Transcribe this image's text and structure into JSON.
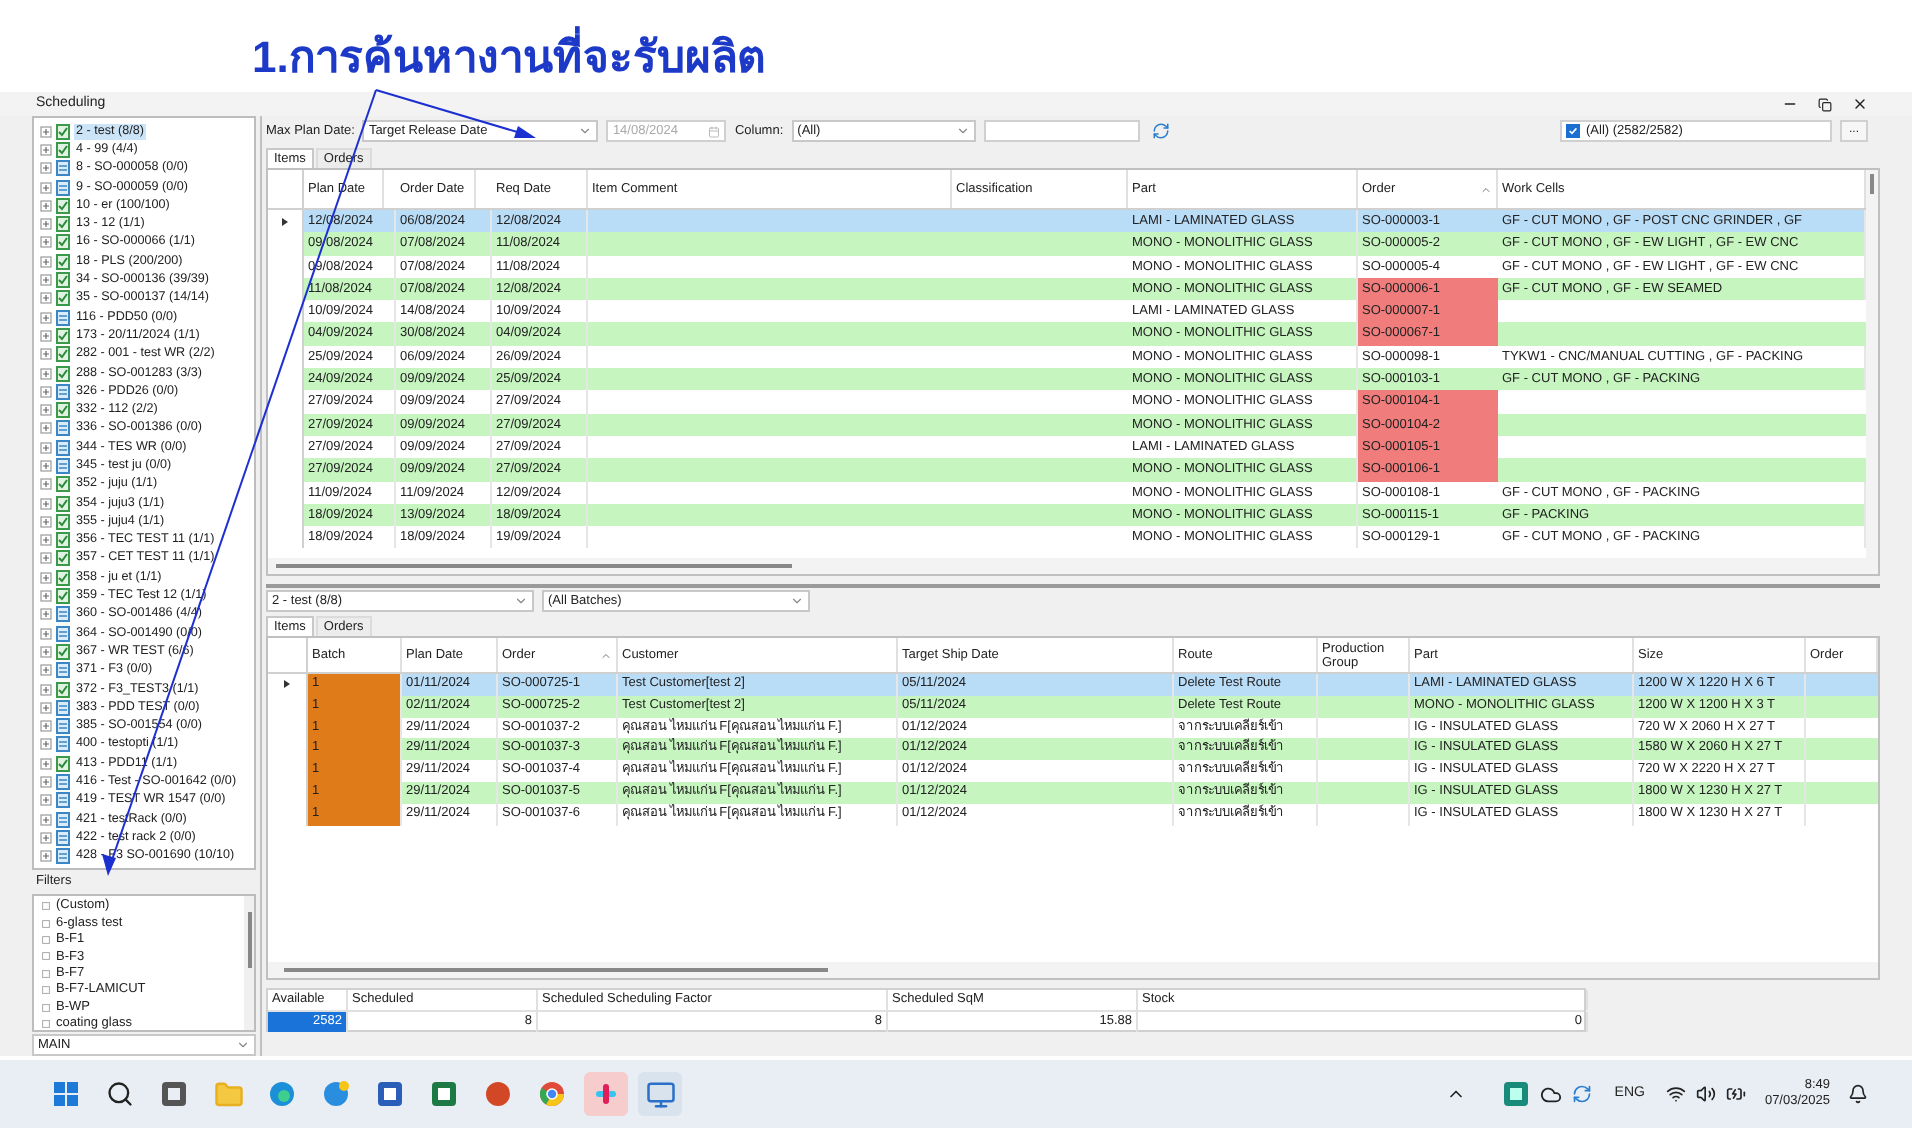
{
  "annotation": {
    "title": "1.การค้นหางานที่จะรับผลิต"
  },
  "window": {
    "title": "Scheduling"
  },
  "tree": [
    {
      "label": "2 - test (8/8)",
      "kind": "complete",
      "selected": true
    },
    {
      "label": "4 - 99 (4/4)",
      "kind": "complete",
      "selected": false
    },
    {
      "label": "8 - SO-000058 (0/0)",
      "kind": "empty",
      "selected": false
    },
    {
      "label": "9 - SO-000059 (0/0)",
      "kind": "empty",
      "selected": false
    },
    {
      "label": "10 - er (100/100)",
      "kind": "complete",
      "selected": false
    },
    {
      "label": "13 - 12 (1/1)",
      "kind": "complete",
      "selected": false
    },
    {
      "label": "16 - SO-000066 (1/1)",
      "kind": "complete",
      "selected": false
    },
    {
      "label": "18 - PLS (200/200)",
      "kind": "complete",
      "selected": false
    },
    {
      "label": "34 - SO-000136 (39/39)",
      "kind": "complete",
      "selected": false
    },
    {
      "label": "35 - SO-000137 (14/14)",
      "kind": "complete",
      "selected": false
    },
    {
      "label": "116 - PDD50 (0/0)",
      "kind": "empty",
      "selected": false
    },
    {
      "label": "173 - 20/11/2024 (1/1)",
      "kind": "complete",
      "selected": false
    },
    {
      "label": "282 - 001 - test WR (2/2)",
      "kind": "complete",
      "selected": false
    },
    {
      "label": "288 - SO-001283 (3/3)",
      "kind": "complete",
      "selected": false
    },
    {
      "label": "326 - PDD26 (0/0)",
      "kind": "empty",
      "selected": false
    },
    {
      "label": "332 - 112 (2/2)",
      "kind": "complete",
      "selected": false
    },
    {
      "label": "336 - SO-001386 (0/0)",
      "kind": "empty",
      "selected": false
    },
    {
      "label": "344 - TES WR (0/0)",
      "kind": "empty",
      "selected": false
    },
    {
      "label": "345 - test ju (0/0)",
      "kind": "empty",
      "selected": false
    },
    {
      "label": "352 - juju (1/1)",
      "kind": "complete",
      "selected": false
    },
    {
      "label": "354 - juju3 (1/1)",
      "kind": "complete",
      "selected": false
    },
    {
      "label": "355 - juju4 (1/1)",
      "kind": "complete",
      "selected": false
    },
    {
      "label": "356 - TEC TEST 11 (1/1)",
      "kind": "complete",
      "selected": false
    },
    {
      "label": "357 - CET TEST 11 (1/1)",
      "kind": "complete",
      "selected": false
    },
    {
      "label": "358 - ju et (1/1)",
      "kind": "complete",
      "selected": false
    },
    {
      "label": "359 - TEC Test 12 (1/1)",
      "kind": "complete",
      "selected": false
    },
    {
      "label": "360 - SO-001486 (4/4)",
      "kind": "empty",
      "selected": false
    },
    {
      "label": "364 - SO-001490 (0/0)",
      "kind": "empty",
      "selected": false
    },
    {
      "label": "367 - WR TEST (6/6)",
      "kind": "complete",
      "selected": false
    },
    {
      "label": "371 - F3 (0/0)",
      "kind": "empty",
      "selected": false
    },
    {
      "label": "372 - F3_TEST3 (1/1)",
      "kind": "complete",
      "selected": false
    },
    {
      "label": "383 - PDD TEST (0/0)",
      "kind": "empty",
      "selected": false
    },
    {
      "label": "385 - SO-001554 (0/0)",
      "kind": "empty",
      "selected": false
    },
    {
      "label": "400 - testopti (1/1)",
      "kind": "empty",
      "selected": false
    },
    {
      "label": "413 - PDD11 (1/1)",
      "kind": "complete",
      "selected": false
    },
    {
      "label": "416 - Test - SO-001642 (0/0)",
      "kind": "empty",
      "selected": false
    },
    {
      "label": "419 - TEST WR 1547 (0/0)",
      "kind": "empty",
      "selected": false
    },
    {
      "label": "421 - testRack (0/0)",
      "kind": "empty",
      "selected": false
    },
    {
      "label": "422 - test rack 2 (0/0)",
      "kind": "empty",
      "selected": false
    },
    {
      "label": "428 - F3 SO-001690 (10/10)",
      "kind": "empty",
      "selected": false
    }
  ],
  "filters": {
    "title": "Filters",
    "items": [
      "(Custom)",
      "6-glass test",
      "B-F1",
      "B-F3",
      "B-F7",
      "B-F7-LAMICUT",
      "B-WP",
      "coating glass"
    ],
    "group": "MAIN"
  },
  "toolbar": {
    "max_plan_date_label": "Max Plan Date:",
    "date_type": "Target Release Date",
    "date": "14/08/2024",
    "columns_label": "Column:",
    "columns_value": "(All)",
    "all_filter": {
      "label": "(All) (2582/2582)",
      "checked": true
    },
    "more_button": "..."
  },
  "top_tabs": [
    {
      "label": "Items",
      "selected": true
    },
    {
      "label": "Orders",
      "selected": false
    }
  ],
  "items_table": {
    "columns": [
      "Plan Date",
      "Order Date",
      "Req Date",
      "Item Comment",
      "Classification",
      "Part",
      "Order",
      "Work Cells"
    ],
    "rows": [
      {
        "plan_date": "12/08/2024",
        "order_date": "06/08/2024",
        "req_date": "12/08/2024",
        "part": "LAMI - LAMINATED GLASS",
        "order": "SO-000003-1",
        "order_flagged": false,
        "work_cells": "GF - CUT MONO , GF - POST CNC GRINDER , GF",
        "selected": true
      },
      {
        "plan_date": "09/08/2024",
        "order_date": "07/08/2024",
        "req_date": "11/08/2024",
        "part": "MONO - MONOLITHIC GLASS",
        "order": "SO-000005-2",
        "order_flagged": false,
        "work_cells": "GF - CUT MONO , GF - EW LIGHT , GF - EW CNC",
        "selected": false
      },
      {
        "plan_date": "09/08/2024",
        "order_date": "07/08/2024",
        "req_date": "11/08/2024",
        "part": "MONO - MONOLITHIC GLASS",
        "order": "SO-000005-4",
        "order_flagged": false,
        "work_cells": "GF - CUT MONO , GF - EW LIGHT , GF - EW CNC",
        "selected": false
      },
      {
        "plan_date": "11/08/2024",
        "order_date": "07/08/2024",
        "req_date": "12/08/2024",
        "part": "MONO - MONOLITHIC GLASS",
        "order": "SO-000006-1",
        "order_flagged": true,
        "work_cells": "GF - CUT MONO , GF - EW SEAMED",
        "selected": false
      },
      {
        "plan_date": "10/09/2024",
        "order_date": "14/08/2024",
        "req_date": "10/09/2024",
        "part": "LAMI - LAMINATED GLASS",
        "order": "SO-000007-1",
        "order_flagged": true,
        "selected": false
      },
      {
        "plan_date": "04/09/2024",
        "order_date": "30/08/2024",
        "req_date": "04/09/2024",
        "part": "MONO - MONOLITHIC GLASS",
        "order": "SO-000067-1",
        "order_flagged": true,
        "selected": false
      },
      {
        "plan_date": "25/09/2024",
        "order_date": "06/09/2024",
        "req_date": "26/09/2024",
        "part": "MONO - MONOLITHIC GLASS",
        "order": "SO-000098-1",
        "order_flagged": false,
        "work_cells": "TYKW1 - CNC/MANUAL CUTTING , GF - PACKING",
        "selected": false
      },
      {
        "plan_date": "24/09/2024",
        "order_date": "09/09/2024",
        "req_date": "25/09/2024",
        "part": "MONO - MONOLITHIC GLASS",
        "order": "SO-000103-1",
        "order_flagged": false,
        "work_cells": "GF - CUT MONO , GF - PACKING",
        "selected": false
      },
      {
        "plan_date": "27/09/2024",
        "order_date": "09/09/2024",
        "req_date": "27/09/2024",
        "part": "MONO - MONOLITHIC GLASS",
        "order": "SO-000104-1",
        "order_flagged": true,
        "selected": false
      },
      {
        "plan_date": "27/09/2024",
        "order_date": "09/09/2024",
        "req_date": "27/09/2024",
        "part": "MONO - MONOLITHIC GLASS",
        "order": "SO-000104-2",
        "order_flagged": true,
        "selected": false
      },
      {
        "plan_date": "27/09/2024",
        "order_date": "09/09/2024",
        "req_date": "27/09/2024",
        "part": "LAMI - LAMINATED GLASS",
        "order": "SO-000105-1",
        "order_flagged": true,
        "selected": false
      },
      {
        "plan_date": "27/09/2024",
        "order_date": "09/09/2024",
        "req_date": "27/09/2024",
        "part": "MONO - MONOLITHIC GLASS",
        "order": "SO-000106-1",
        "order_flagged": true,
        "selected": false
      },
      {
        "plan_date": "11/09/2024",
        "order_date": "11/09/2024",
        "req_date": "12/09/2024",
        "part": "MONO - MONOLITHIC GLASS",
        "order": "SO-000108-1",
        "order_flagged": false,
        "work_cells": "GF - CUT MONO , GF - PACKING",
        "selected": false
      },
      {
        "plan_date": "18/09/2024",
        "order_date": "13/09/2024",
        "req_date": "18/09/2024",
        "part": "MONO - MONOLITHIC GLASS",
        "order": "SO-000115-1",
        "order_flagged": false,
        "work_cells": "GF - PACKING",
        "selected": false
      },
      {
        "plan_date": "18/09/2024",
        "order_date": "18/09/2024",
        "req_date": "19/09/2024",
        "part": "MONO - MONOLITHIC GLASS",
        "order": "SO-000129-1",
        "order_flagged": false,
        "work_cells": "GF - CUT MONO , GF - PACKING",
        "selected": false
      }
    ]
  },
  "batch_bar": {
    "order_select": "2 - test (8/8)",
    "batch_select": "(All Batches)"
  },
  "bottom_tabs": [
    {
      "label": "Items",
      "selected": true
    },
    {
      "label": "Orders",
      "selected": false
    }
  ],
  "orders_table": {
    "columns": [
      "Batch",
      "Plan Date",
      "Order",
      "Customer",
      "Target Ship Date",
      "Route",
      "Production Group",
      "Part",
      "Size",
      "Order"
    ],
    "rows": [
      {
        "batch": "1",
        "plan_date": "01/11/2024",
        "order": "SO-000725-1",
        "customer": "Test Customer[test 2]",
        "ship_date": "05/11/2024",
        "route": "Delete Test Route",
        "part": "LAMI - LAMINATED GLASS",
        "size": "1200 W X 1220 H X 6 T",
        "selected": true
      },
      {
        "batch": "1",
        "plan_date": "02/11/2024",
        "order": "SO-000725-2",
        "customer": "Test Customer[test 2]",
        "ship_date": "05/11/2024",
        "route": "Delete Test Route",
        "part": "MONO - MONOLITHIC GLASS",
        "size": "1200 W X 1200 H X 3 T",
        "selected": false
      },
      {
        "batch": "1",
        "plan_date": "29/11/2024",
        "order": "SO-001037-2",
        "customer": "คุณสอน ไหมแก่น F[คุณสอน ไหมแก่น F.]",
        "ship_date": "01/12/2024",
        "route": "จากระบบเคลียร์เข้า",
        "part": "IG - INSULATED GLASS",
        "size": "720 W X 2060 H X 27 T",
        "selected": false
      },
      {
        "batch": "1",
        "plan_date": "29/11/2024",
        "order": "SO-001037-3",
        "customer": "คุณสอน ไหมแก่น F[คุณสอน ไหมแก่น F.]",
        "ship_date": "01/12/2024",
        "route": "จากระบบเคลียร์เข้า",
        "part": "IG - INSULATED GLASS",
        "size": "1580 W X 2060 H X 27 T",
        "selected": false
      },
      {
        "batch": "1",
        "plan_date": "29/11/2024",
        "order": "SO-001037-4",
        "customer": "คุณสอน ไหมแก่น F[คุณสอน ไหมแก่น F.]",
        "ship_date": "01/12/2024",
        "route": "จากระบบเคลียร์เข้า",
        "part": "IG - INSULATED GLASS",
        "size": "720 W X 2220 H X 27 T",
        "selected": false
      },
      {
        "batch": "1",
        "plan_date": "29/11/2024",
        "order": "SO-001037-5",
        "customer": "คุณสอน ไหมแก่น F[คุณสอน ไหมแก่น F.]",
        "ship_date": "01/12/2024",
        "route": "จากระบบเคลียร์เข้า",
        "part": "IG - INSULATED GLASS",
        "size": "1800 W X 1230 H X 27 T",
        "selected": false
      },
      {
        "batch": "1",
        "plan_date": "29/11/2024",
        "order": "SO-001037-6",
        "customer": "คุณสอน ไหมแก่น F[คุณสอน ไหมแก่น F.]",
        "ship_date": "01/12/2024",
        "route": "จากระบบเคลียร์เข้า",
        "part": "IG - INSULATED GLASS",
        "size": "1800 W X 1230 H X 27 T",
        "selected": false
      }
    ]
  },
  "summary": {
    "columns": [
      "Available",
      "Scheduled",
      "Scheduled Scheduling Factor",
      "Scheduled SqM",
      "Stock"
    ],
    "values": [
      "2582",
      "8",
      "8",
      "15.88",
      "0"
    ]
  },
  "taskbar": {
    "language": "ENG",
    "time": "8:49",
    "date": "07/03/2025"
  }
}
